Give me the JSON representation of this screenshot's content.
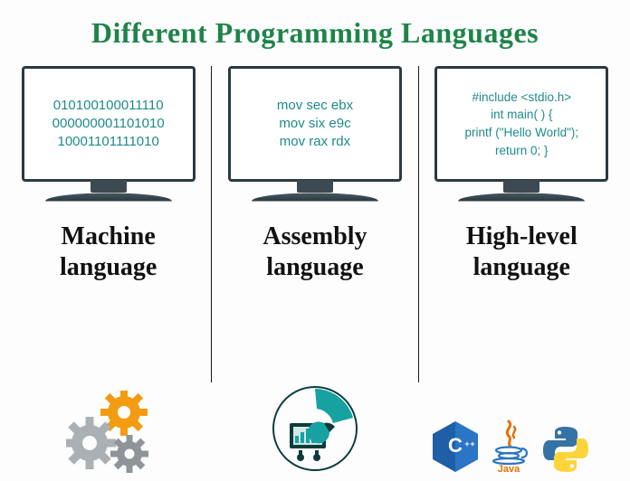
{
  "title": "Different Programming Languages",
  "columns": [
    {
      "label_line1": "Machine",
      "label_line2": "language",
      "code_lines": [
        "010100100011110",
        "000000001101010",
        "10001101111010"
      ]
    },
    {
      "label_line1": "Assembly",
      "label_line2": "language",
      "code_lines": [
        "mov sec ebx",
        "mov six e9c",
        "mov rax rdx"
      ]
    },
    {
      "label_line1": "High-level",
      "label_line2": "language",
      "code_lines": [
        "#include <stdio.h>",
        "int main( ) {",
        "printf (\"Hello World\");",
        "return 0; }"
      ]
    }
  ],
  "logos": {
    "cpp": "C++",
    "java": "Java",
    "python": "Python"
  }
}
